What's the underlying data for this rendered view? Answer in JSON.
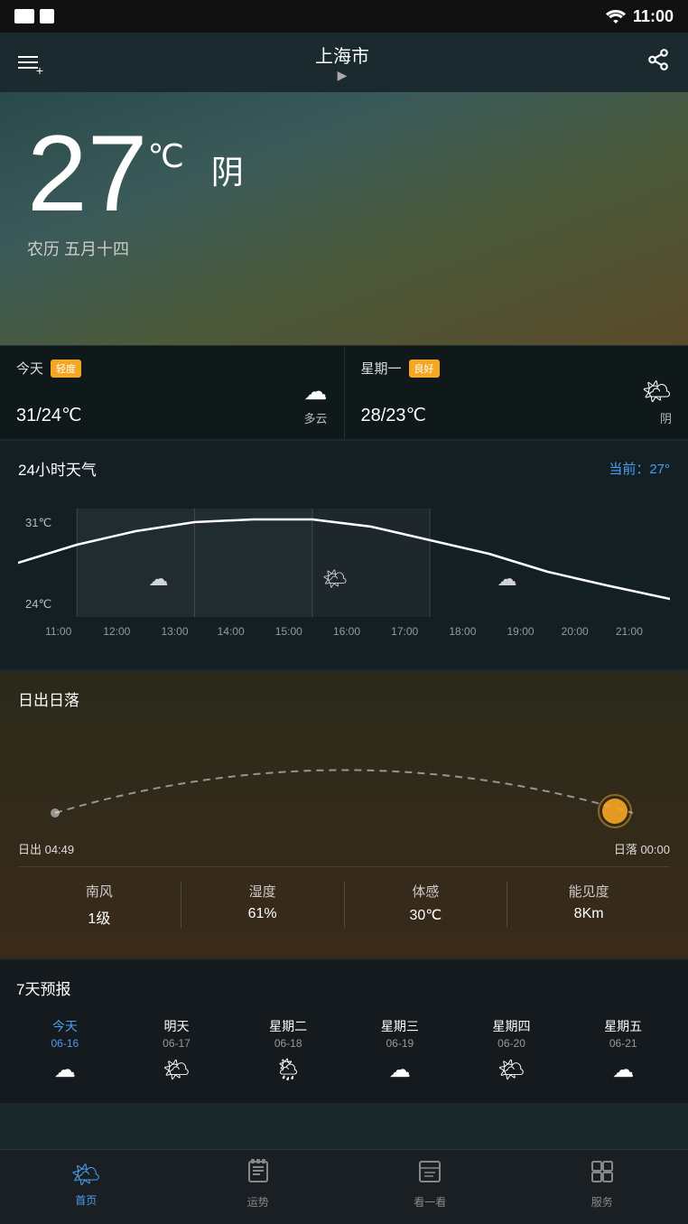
{
  "statusBar": {
    "time": "11:00"
  },
  "topBar": {
    "cityName": "上海市",
    "menuIcon": "≡+",
    "shareIcon": "share"
  },
  "hero": {
    "temperature": "27",
    "unit": "℃",
    "weatherDesc": "阴",
    "lunarDate": "农历 五月十四"
  },
  "todayForecast": {
    "label": "今天",
    "aqi": "轻度",
    "temp": "31/24℃",
    "weatherIcon": "☁",
    "weatherLabel": "多云"
  },
  "tomorrowForecast": {
    "label": "星期一",
    "aqi": "良好",
    "temp": "28/23℃",
    "weatherIcon": "🌤",
    "weatherLabel": "阴"
  },
  "hourlySection": {
    "title": "24小时天气",
    "current": "当前：27°",
    "hours": [
      "11:00",
      "12:00",
      "13:00",
      "14:00",
      "15:00",
      "16:00",
      "17:00",
      "18:00",
      "19:00",
      "20:00",
      "21:00"
    ],
    "temps": [
      27,
      29,
      30,
      31,
      31,
      30,
      29,
      28,
      27,
      25,
      24
    ],
    "minTemp": "24℃",
    "maxTemp": "31℃"
  },
  "sunriseSection": {
    "title": "日出日落",
    "sunriseTime": "日出 04:49",
    "sunsetTime": "日落 00:00"
  },
  "weatherDetails": {
    "wind": {
      "label": "南风",
      "value": "1级"
    },
    "humidity": {
      "label": "湿度",
      "value": "61%"
    },
    "feelsLike": {
      "label": "体感",
      "value": "30℃"
    },
    "visibility": {
      "label": "能见度",
      "value": "8Km"
    }
  },
  "forecast": {
    "title": "7天预报",
    "days": [
      {
        "name": "今天",
        "date": "06-16",
        "icon": "☁",
        "isToday": true
      },
      {
        "name": "明天",
        "date": "06-17",
        "icon": "🌤",
        "isToday": false
      },
      {
        "name": "星期二",
        "date": "06-18",
        "icon": "🌦",
        "isToday": false
      },
      {
        "name": "星期三",
        "date": "06-19",
        "icon": "☁",
        "isToday": false
      },
      {
        "name": "星期四",
        "date": "06-20",
        "icon": "🌤",
        "isToday": false
      },
      {
        "name": "星期五",
        "date": "06-21",
        "icon": "☁",
        "isToday": false
      }
    ]
  },
  "bottomNav": {
    "items": [
      {
        "id": "home",
        "label": "首页",
        "icon": "🌤",
        "active": true
      },
      {
        "id": "fortune",
        "label": "运势",
        "icon": "📅",
        "active": false
      },
      {
        "id": "look",
        "label": "看一看",
        "icon": "📰",
        "active": false
      },
      {
        "id": "services",
        "label": "服务",
        "icon": "⚙",
        "active": false
      }
    ]
  }
}
